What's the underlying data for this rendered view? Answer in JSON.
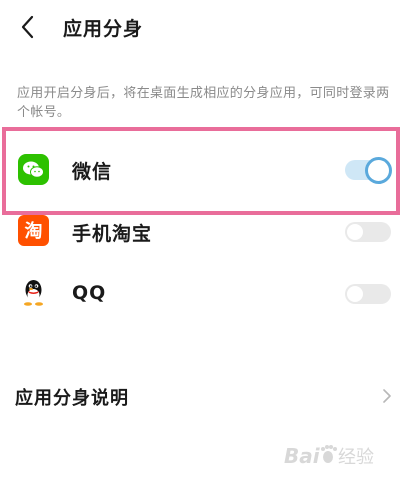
{
  "header": {
    "title": "应用分身",
    "back_icon": "chevron-left-icon"
  },
  "description": "应用开启分身后，将在桌面生成相应的分身应用，可同时登录两个帐号。",
  "apps": [
    {
      "label": "微信",
      "icon": "wechat-icon",
      "enabled": true,
      "accent": "#2dc100"
    },
    {
      "label": "手机淘宝",
      "icon": "taobao-icon",
      "enabled": false,
      "accent": "#ff5000"
    },
    {
      "label": "QQ",
      "icon": "qq-icon",
      "enabled": false,
      "accent": "#000000"
    }
  ],
  "footer": {
    "label": "应用分身说明",
    "icon": "chevron-right-icon"
  },
  "colors": {
    "toggle_on": "#5aa9dc",
    "highlight": "#e96d9a"
  }
}
